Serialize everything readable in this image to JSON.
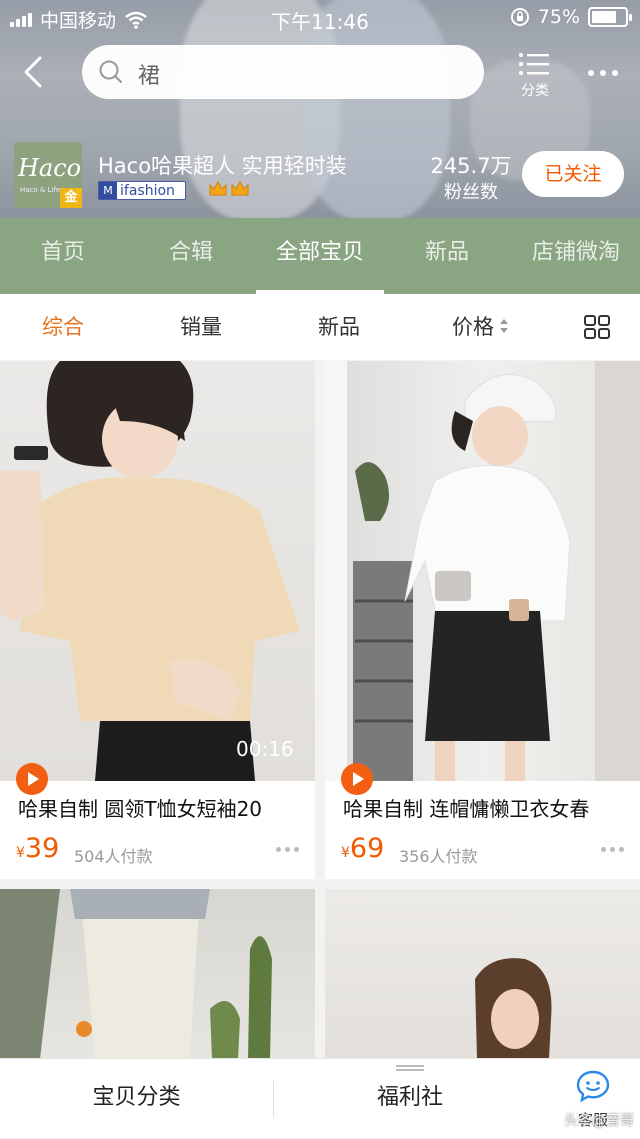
{
  "status_bar": {
    "carrier": "中国移动",
    "time": "下午11:46",
    "battery_text": "75%",
    "battery_level": 0.75
  },
  "nav": {
    "search_text": "裙",
    "category_label": "分类"
  },
  "shop": {
    "name": "Haco哈果超人 实用轻时装",
    "logo_text": "Haco",
    "logo_sub": "Haco & Life",
    "badge_gold": "金",
    "ifashion_badge": "ifashion",
    "followers_count": "245.7万",
    "followers_label": "粉丝数",
    "follow_button": "已关注"
  },
  "shop_tabs": [
    {
      "label": "首页"
    },
    {
      "label": "合辑"
    },
    {
      "label": "全部宝贝"
    },
    {
      "label": "新品"
    },
    {
      "label": "店铺微淘"
    }
  ],
  "active_shop_tab": "全部宝贝",
  "sort_bar": {
    "items": [
      "综合",
      "销量",
      "新品",
      "价格"
    ],
    "active": "综合"
  },
  "products": [
    {
      "title": "哈果自制 圆领T恤女短袖20",
      "currency": "¥",
      "price": "39",
      "sales": "504人付款",
      "video_duration": "00:16",
      "has_video": true
    },
    {
      "title": "哈果自制 连帽慵懒卫衣女春",
      "currency": "¥",
      "price": "69",
      "sales": "356人付款",
      "video_duration": "",
      "has_video": true
    },
    {
      "title": "",
      "currency": "",
      "price": "",
      "sales": "",
      "video_duration": "",
      "has_video": false
    },
    {
      "title": "",
      "currency": "",
      "price": "",
      "sales": "",
      "video_duration": "",
      "has_video": false
    }
  ],
  "bottom_bar": {
    "category": "宝贝分类",
    "welfare": "福利社",
    "service": "客服"
  },
  "watermark": "头条@音哥",
  "colors": {
    "accent_orange": "#f05a00",
    "sort_active": "#e4751f",
    "shop_tab_bg": "#8aa582",
    "logo_bg": "#8fa27f"
  }
}
